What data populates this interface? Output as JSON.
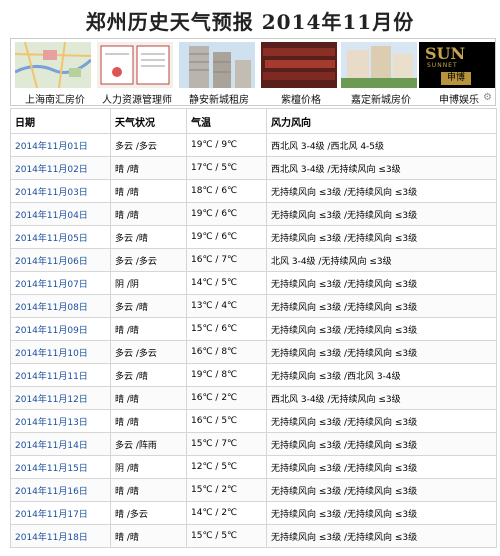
{
  "page_title": "郑州历史天气预报 2014年11月份",
  "ads": [
    {
      "label": "上海南汇房价",
      "icon": "map-thumbnail"
    },
    {
      "label": "人力资源管理师",
      "icon": "certificate-thumbnail"
    },
    {
      "label": "静安新城租房",
      "icon": "tower-thumbnail"
    },
    {
      "label": "紫檀价格",
      "icon": "wood-thumbnail"
    },
    {
      "label": "嘉定新城房价",
      "icon": "building-thumbnail"
    },
    {
      "label": "申博娱乐",
      "icon": "sunnet-thumbnail",
      "logo_text": "SUN",
      "logo_sub": "SUNNET",
      "badge": "申博"
    }
  ],
  "table": {
    "headers": [
      "日期",
      "天气状况",
      "气温",
      "风力风向"
    ],
    "rows": [
      {
        "date": "2014年11月01日",
        "weather": "多云 /多云",
        "temp": "19℃ / 9℃",
        "wind": "西北风 3-4级 /西北风 4-5级"
      },
      {
        "date": "2014年11月02日",
        "weather": "晴 /晴",
        "temp": "17℃ / 5℃",
        "wind": "西北风 3-4级 /无持续风向 ≤3级"
      },
      {
        "date": "2014年11月03日",
        "weather": "晴 /晴",
        "temp": "18℃ / 6℃",
        "wind": "无持续风向 ≤3级 /无持续风向 ≤3级"
      },
      {
        "date": "2014年11月04日",
        "weather": "晴 /晴",
        "temp": "19℃ / 6℃",
        "wind": "无持续风向 ≤3级 /无持续风向 ≤3级"
      },
      {
        "date": "2014年11月05日",
        "weather": "多云 /晴",
        "temp": "19℃ / 6℃",
        "wind": "无持续风向 ≤3级 /无持续风向 ≤3级"
      },
      {
        "date": "2014年11月06日",
        "weather": "多云 /多云",
        "temp": "16℃ / 7℃",
        "wind": "北风 3-4级 /无持续风向 ≤3级"
      },
      {
        "date": "2014年11月07日",
        "weather": "阴 /阴",
        "temp": "14℃ / 5℃",
        "wind": "无持续风向 ≤3级 /无持续风向 ≤3级"
      },
      {
        "date": "2014年11月08日",
        "weather": "多云 /晴",
        "temp": "13℃ / 4℃",
        "wind": "无持续风向 ≤3级 /无持续风向 ≤3级"
      },
      {
        "date": "2014年11月09日",
        "weather": "晴 /晴",
        "temp": "15℃ / 6℃",
        "wind": "无持续风向 ≤3级 /无持续风向 ≤3级"
      },
      {
        "date": "2014年11月10日",
        "weather": "多云 /多云",
        "temp": "16℃ / 8℃",
        "wind": "无持续风向 ≤3级 /无持续风向 ≤3级"
      },
      {
        "date": "2014年11月11日",
        "weather": "多云 /晴",
        "temp": "19℃ / 8℃",
        "wind": "无持续风向 ≤3级 /西北风 3-4级"
      },
      {
        "date": "2014年11月12日",
        "weather": "晴 /晴",
        "temp": "16℃ / 2℃",
        "wind": "西北风 3-4级 /无持续风向 ≤3级"
      },
      {
        "date": "2014年11月13日",
        "weather": "晴 /晴",
        "temp": "16℃ / 5℃",
        "wind": "无持续风向 ≤3级 /无持续风向 ≤3级"
      },
      {
        "date": "2014年11月14日",
        "weather": "多云 /阵雨",
        "temp": "15℃ / 7℃",
        "wind": "无持续风向 ≤3级 /无持续风向 ≤3级"
      },
      {
        "date": "2014年11月15日",
        "weather": "阴 /晴",
        "temp": "12℃ / 5℃",
        "wind": "无持续风向 ≤3级 /无持续风向 ≤3级"
      },
      {
        "date": "2014年11月16日",
        "weather": "晴 /晴",
        "temp": "15℃ / 2℃",
        "wind": "无持续风向 ≤3级 /无持续风向 ≤3级"
      },
      {
        "date": "2014年11月17日",
        "weather": "晴 /多云",
        "temp": "14℃ / 2℃",
        "wind": "无持续风向 ≤3级 /无持续风向 ≤3级"
      },
      {
        "date": "2014年11月18日",
        "weather": "晴 /晴",
        "temp": "15℃ / 5℃",
        "wind": "无持续风向 ≤3级 /无持续风向 ≤3级"
      }
    ]
  }
}
